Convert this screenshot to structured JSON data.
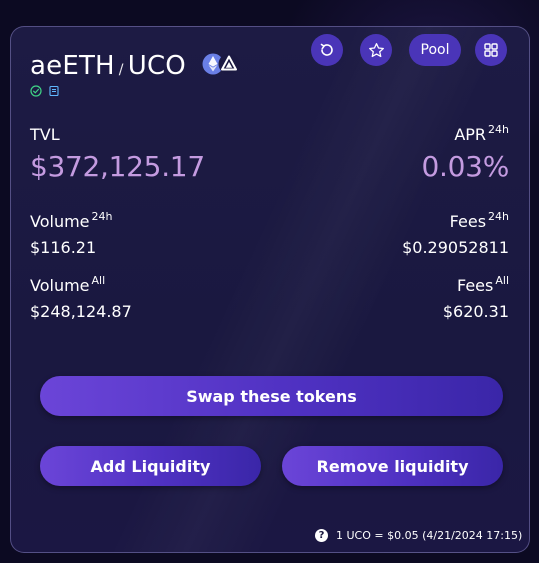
{
  "header": {
    "pool_label": "Pool",
    "icons": [
      "refresh-icon",
      "star-icon",
      "grid-icon"
    ]
  },
  "pair": {
    "token_a": "aeETH",
    "separator": "/",
    "token_b": "UCO",
    "token_icons": [
      "ethereum-token-icon",
      "archethic-token-icon"
    ],
    "badges": [
      "verified-check-icon",
      "contract-document-icon"
    ]
  },
  "stats": {
    "tvl_label": "TVL",
    "tvl_value": "$372,125.17",
    "apr_label": "APR",
    "apr_sup": "24h",
    "apr_value": "0.03%",
    "volume_24h_label": "Volume",
    "volume_24h_sup": "24h",
    "volume_24h_value": "$116.21",
    "fees_24h_label": "Fees",
    "fees_24h_sup": "24h",
    "fees_24h_value": "$0.29052811",
    "volume_all_label": "Volume",
    "volume_all_sup": "All",
    "volume_all_value": "$248,124.87",
    "fees_all_label": "Fees",
    "fees_all_sup": "All",
    "fees_all_value": "$620.31"
  },
  "actions": {
    "swap": "Swap these tokens",
    "add_liquidity": "Add Liquidity",
    "remove_liquidity": "Remove liquidity"
  },
  "footer": {
    "help": "?",
    "rate": "1 UCO = $0.05 (4/21/2024 17:15)"
  },
  "colors": {
    "accent": "#4a35b8",
    "highlight": "#c49be0",
    "card": "#1c1a43"
  }
}
